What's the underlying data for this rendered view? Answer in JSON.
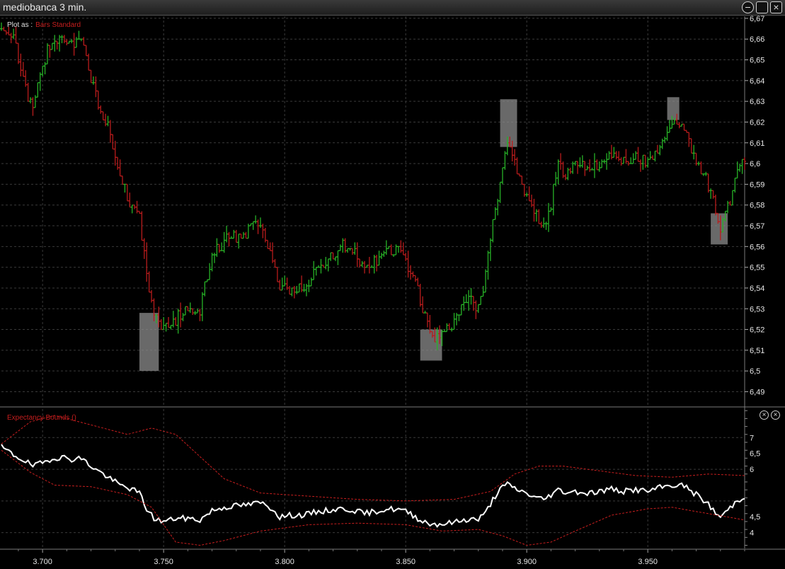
{
  "window": {
    "title": "mediobanca  3 min."
  },
  "price_panel": {
    "plot_as_label": "Plot as :",
    "plot_as_value": "Bars Standard"
  },
  "indicator_panel": {
    "label": "Expectancy Bounds ()"
  },
  "colors": {
    "up": "#27b227",
    "down": "#b81c1c",
    "line": "#ffffff",
    "bounds": "#c81e1e",
    "grid": "#3a3a3a",
    "highlight": "#8c8c8c"
  },
  "chart_data": [
    {
      "type": "bar",
      "subtype": "ohlc-bars",
      "title": "",
      "xlabel": "",
      "ylabel": "",
      "x_ticks": [
        "3.700",
        "3.750",
        "3.800",
        "3.850",
        "3.900",
        "3.950"
      ],
      "y_ticks": [
        "6,67",
        "6,66",
        "6,65",
        "6,64",
        "6,63",
        "6,62",
        "6,61",
        "6,6",
        "6,59",
        "6,58",
        "6,57",
        "6,56",
        "6,55",
        "6,54",
        "6,53",
        "6,52",
        "6,51",
        "6,5",
        "6,49"
      ],
      "xlim": [
        3683,
        3990
      ],
      "ylim": [
        6.483,
        6.671
      ],
      "grid": true,
      "close_anchors": [
        [
          3683,
          6.665
        ],
        [
          3688,
          6.662
        ],
        [
          3692,
          6.64
        ],
        [
          3696,
          6.625
        ],
        [
          3700,
          6.648
        ],
        [
          3704,
          6.66
        ],
        [
          3708,
          6.662
        ],
        [
          3712,
          6.658
        ],
        [
          3716,
          6.66
        ],
        [
          3720,
          6.64
        ],
        [
          3724,
          6.625
        ],
        [
          3728,
          6.615
        ],
        [
          3732,
          6.595
        ],
        [
          3736,
          6.58
        ],
        [
          3740,
          6.575
        ],
        [
          3743,
          6.545
        ],
        [
          3746,
          6.528
        ],
        [
          3750,
          6.52
        ],
        [
          3755,
          6.525
        ],
        [
          3760,
          6.53
        ],
        [
          3765,
          6.53
        ],
        [
          3770,
          6.555
        ],
        [
          3775,
          6.562
        ],
        [
          3780,
          6.565
        ],
        [
          3785,
          6.568
        ],
        [
          3790,
          6.572
        ],
        [
          3795,
          6.555
        ],
        [
          3798,
          6.538
        ],
        [
          3803,
          6.54
        ],
        [
          3808,
          6.54
        ],
        [
          3813,
          6.548
        ],
        [
          3818,
          6.553
        ],
        [
          3823,
          6.56
        ],
        [
          3828,
          6.56
        ],
        [
          3833,
          6.548
        ],
        [
          3838,
          6.553
        ],
        [
          3843,
          6.558
        ],
        [
          3848,
          6.558
        ],
        [
          3852,
          6.548
        ],
        [
          3856,
          6.535
        ],
        [
          3860,
          6.518
        ],
        [
          3864,
          6.515
        ],
        [
          3868,
          6.52
        ],
        [
          3872,
          6.528
        ],
        [
          3876,
          6.535
        ],
        [
          3880,
          6.53
        ],
        [
          3883,
          6.545
        ],
        [
          3886,
          6.575
        ],
        [
          3889,
          6.59
        ],
        [
          3892,
          6.61
        ],
        [
          3895,
          6.6
        ],
        [
          3898,
          6.59
        ],
        [
          3901,
          6.58
        ],
        [
          3904,
          6.575
        ],
        [
          3907,
          6.57
        ],
        [
          3910,
          6.58
        ],
        [
          3913,
          6.6
        ],
        [
          3916,
          6.595
        ],
        [
          3920,
          6.6
        ],
        [
          3925,
          6.598
        ],
        [
          3930,
          6.6
        ],
        [
          3935,
          6.605
        ],
        [
          3940,
          6.6
        ],
        [
          3945,
          6.603
        ],
        [
          3950,
          6.6
        ],
        [
          3955,
          6.61
        ],
        [
          3960,
          6.62
        ],
        [
          3965,
          6.618
        ],
        [
          3970,
          6.6
        ],
        [
          3975,
          6.59
        ],
        [
          3978,
          6.578
        ],
        [
          3980,
          6.567
        ],
        [
          3983,
          6.578
        ],
        [
          3986,
          6.593
        ],
        [
          3990,
          6.602
        ]
      ],
      "highlights": [
        {
          "x": [
            3740,
            3748
          ],
          "y": [
            6.5,
            6.528
          ]
        },
        {
          "x": [
            3856,
            3865
          ],
          "y": [
            6.505,
            6.52
          ]
        },
        {
          "x": [
            3889,
            3896
          ],
          "y": [
            6.608,
            6.631
          ]
        },
        {
          "x": [
            3958,
            3963
          ],
          "y": [
            6.621,
            6.632
          ]
        },
        {
          "x": [
            3976,
            3983
          ],
          "y": [
            6.561,
            6.576
          ]
        }
      ]
    },
    {
      "type": "line",
      "title": "",
      "xlim": [
        3683,
        3990
      ],
      "ylim": [
        3.5,
        7.9
      ],
      "y_ticks": [
        "7",
        "6,5",
        "6",
        "4,5",
        "4"
      ],
      "y_tick_values": [
        7,
        6.5,
        6,
        4.5,
        4
      ],
      "series": [
        {
          "name": "",
          "kind": "signal",
          "values": [
            [
              3683,
              6.7
            ],
            [
              3688,
              6.45
            ],
            [
              3692,
              6.3
            ],
            [
              3696,
              6.1
            ],
            [
              3700,
              6.2
            ],
            [
              3704,
              6.35
            ],
            [
              3708,
              6.38
            ],
            [
              3712,
              6.32
            ],
            [
              3716,
              6.35
            ],
            [
              3720,
              6.1
            ],
            [
              3724,
              5.9
            ],
            [
              3728,
              5.7
            ],
            [
              3732,
              5.5
            ],
            [
              3736,
              5.4
            ],
            [
              3740,
              5.25
            ],
            [
              3743,
              4.75
            ],
            [
              3746,
              4.45
            ],
            [
              3750,
              4.35
            ],
            [
              3755,
              4.45
            ],
            [
              3760,
              4.45
            ],
            [
              3765,
              4.4
            ],
            [
              3770,
              4.7
            ],
            [
              3775,
              4.8
            ],
            [
              3780,
              4.85
            ],
            [
              3785,
              4.88
            ],
            [
              3790,
              4.95
            ],
            [
              3795,
              4.75
            ],
            [
              3798,
              4.5
            ],
            [
              3803,
              4.55
            ],
            [
              3808,
              4.55
            ],
            [
              3813,
              4.65
            ],
            [
              3818,
              4.7
            ],
            [
              3823,
              4.75
            ],
            [
              3828,
              4.72
            ],
            [
              3833,
              4.6
            ],
            [
              3838,
              4.68
            ],
            [
              3843,
              4.75
            ],
            [
              3848,
              4.72
            ],
            [
              3852,
              4.6
            ],
            [
              3856,
              4.4
            ],
            [
              3860,
              4.28
            ],
            [
              3864,
              4.27
            ],
            [
              3868,
              4.3
            ],
            [
              3872,
              4.36
            ],
            [
              3876,
              4.43
            ],
            [
              3880,
              4.42
            ],
            [
              3883,
              4.62
            ],
            [
              3886,
              5.05
            ],
            [
              3889,
              5.38
            ],
            [
              3892,
              5.52
            ],
            [
              3895,
              5.4
            ],
            [
              3898,
              5.3
            ],
            [
              3901,
              5.2
            ],
            [
              3904,
              5.1
            ],
            [
              3907,
              5.05
            ],
            [
              3910,
              5.2
            ],
            [
              3913,
              5.35
            ],
            [
              3916,
              5.28
            ],
            [
              3920,
              5.3
            ],
            [
              3925,
              5.25
            ],
            [
              3930,
              5.3
            ],
            [
              3935,
              5.38
            ],
            [
              3940,
              5.3
            ],
            [
              3945,
              5.36
            ],
            [
              3950,
              5.3
            ],
            [
              3955,
              5.42
            ],
            [
              3960,
              5.5
            ],
            [
              3965,
              5.48
            ],
            [
              3970,
              5.2
            ],
            [
              3975,
              4.9
            ],
            [
              3978,
              4.6
            ],
            [
              3980,
              4.5
            ],
            [
              3983,
              4.7
            ],
            [
              3986,
              4.95
            ],
            [
              3990,
              5.15
            ]
          ]
        },
        {
          "name": "",
          "kind": "upper-bound",
          "values": [
            [
              3683,
              6.8
            ],
            [
              3695,
              7.5
            ],
            [
              3705,
              7.7
            ],
            [
              3720,
              7.4
            ],
            [
              3735,
              7.1
            ],
            [
              3745,
              7.3
            ],
            [
              3755,
              7.1
            ],
            [
              3765,
              6.4
            ],
            [
              3775,
              5.7
            ],
            [
              3790,
              5.25
            ],
            [
              3810,
              5.15
            ],
            [
              3830,
              5.05
            ],
            [
              3850,
              5.0
            ],
            [
              3870,
              5.05
            ],
            [
              3885,
              5.3
            ],
            [
              3895,
              5.85
            ],
            [
              3905,
              6.1
            ],
            [
              3915,
              6.1
            ],
            [
              3930,
              5.95
            ],
            [
              3945,
              5.8
            ],
            [
              3960,
              5.75
            ],
            [
              3975,
              5.85
            ],
            [
              3990,
              5.8
            ]
          ]
        },
        {
          "name": "",
          "kind": "lower-bound",
          "values": [
            [
              3683,
              6.6
            ],
            [
              3695,
              5.9
            ],
            [
              3705,
              5.5
            ],
            [
              3720,
              5.45
            ],
            [
              3735,
              5.2
            ],
            [
              3745,
              4.8
            ],
            [
              3755,
              3.7
            ],
            [
              3765,
              3.6
            ],
            [
              3775,
              3.75
            ],
            [
              3790,
              4.05
            ],
            [
              3810,
              4.25
            ],
            [
              3830,
              4.3
            ],
            [
              3850,
              4.25
            ],
            [
              3865,
              4.05
            ],
            [
              3880,
              4.1
            ],
            [
              3890,
              3.9
            ],
            [
              3900,
              3.6
            ],
            [
              3910,
              3.7
            ],
            [
              3920,
              4.05
            ],
            [
              3935,
              4.55
            ],
            [
              3950,
              4.75
            ],
            [
              3960,
              4.8
            ],
            [
              3975,
              4.6
            ],
            [
              3990,
              4.4
            ]
          ]
        }
      ],
      "grid": true
    }
  ]
}
